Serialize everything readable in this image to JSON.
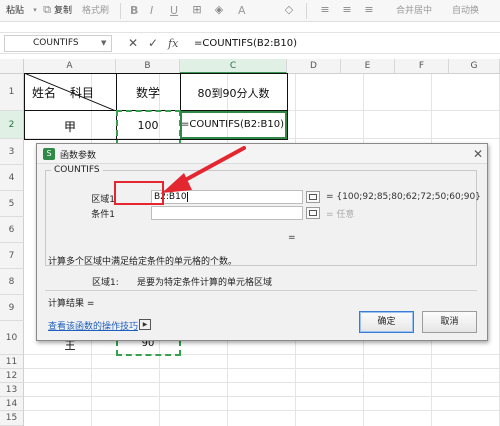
{
  "toolbar": {
    "paste_label": "粘贴",
    "copy_label": "复制",
    "format_painter_label": "格式刷",
    "bold_label": "B",
    "italic_label": "I",
    "underline_label": "U",
    "font_color_label": "A",
    "merge_center_label": "合并居中",
    "auto_wrap_label": "自动换"
  },
  "formula_bar": {
    "name_box": "COUNTIFS",
    "cancel_icon": "✕",
    "confirm_icon": "✓",
    "fx_label": "fx",
    "formula": "=COUNTIFS(B2:B10)"
  },
  "columns": [
    "A",
    "B",
    "C",
    "D",
    "E",
    "F",
    "G"
  ],
  "rows": [
    "1",
    "2",
    "3",
    "4",
    "5",
    "6",
    "7",
    "8",
    "9",
    "10",
    "11",
    "12",
    "13",
    "14",
    "15"
  ],
  "table": {
    "a1_left": "姓名",
    "a1_right": "科目",
    "b1": "数学",
    "c1": "80到90分人数",
    "a2": "甲",
    "b2": "100",
    "c2": "=COUNTIFS(B2:B10)",
    "a10": "王",
    "b10": "90"
  },
  "dialog": {
    "title": "函数参数",
    "logo": "S",
    "close_icon": "✕",
    "function_name": "COUNTIFS",
    "arg1_label": "区域1",
    "arg1_value": "B2:B10",
    "arg1_result": "= {100;92;85;80;62;72;50;60;90}",
    "arg2_label": "条件1",
    "arg2_value": "",
    "arg2_result": "= 任意",
    "total_equals": "=",
    "description": "计算多个区域中满足给定条件的单元格的个数。",
    "arg_desc_label": "区域1:",
    "arg_desc_text": "是要为特定条件计算的单元格区域",
    "result_label": "计算结果 =",
    "help_link": "查看该函数的操作技巧",
    "ok_label": "确定",
    "cancel_label": "取消"
  },
  "colors": {
    "selection_green": "#2f8a47",
    "highlight_red": "#e3262f",
    "link_blue": "#1f5fbf"
  }
}
